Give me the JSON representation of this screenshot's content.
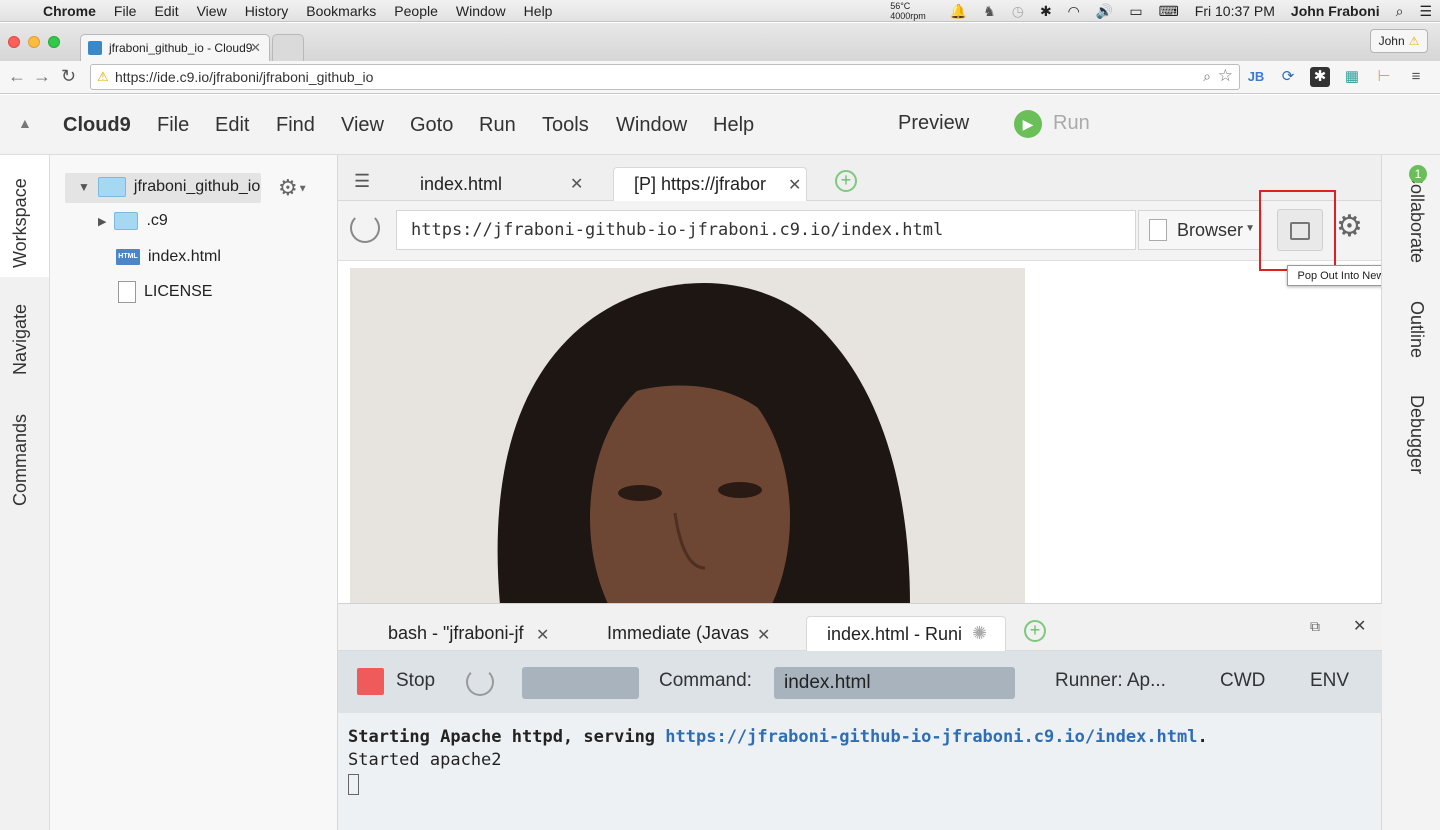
{
  "macbar": {
    "app": "Chrome",
    "menu": [
      "File",
      "Edit",
      "View",
      "History",
      "Bookmarks",
      "People",
      "Window",
      "Help"
    ],
    "temp": "56°C",
    "rpm": "4000rpm",
    "clock": "Fri 10:37 PM",
    "user": "John Fraboni"
  },
  "browser": {
    "tab_title": "jfraboni_github_io - Cloud9",
    "profile": "John",
    "url": "https://ide.c9.io/jfraboni/jfraboni_github_io"
  },
  "ide": {
    "logo": "Cloud9",
    "menu": [
      "File",
      "Edit",
      "Find",
      "View",
      "Goto",
      "Run",
      "Tools",
      "Window",
      "Help"
    ],
    "preview": "Preview",
    "run": "Run"
  },
  "left_tabs": [
    "Workspace",
    "Navigate",
    "Commands"
  ],
  "right_tabs": [
    "Collaborate",
    "Outline",
    "Debugger"
  ],
  "collab_badge": "1",
  "tree": {
    "root": "jfraboni_github_io",
    "items": [
      ".c9",
      "index.html",
      "LICENSE"
    ],
    "html_badge": "HTML"
  },
  "editor": {
    "tabs": [
      "index.html",
      "[P] https://jfrabor"
    ],
    "preview_url": "https://jfraboni-github-io-jfraboni.c9.io/index.html",
    "browser_label": "Browser",
    "tooltip": "Pop Out Into New Window"
  },
  "console": {
    "tabs": [
      "bash - \"jfraboni-jf",
      "Immediate (Javas",
      "index.html - Runi"
    ],
    "stop": "Stop",
    "command_label": "Command:",
    "command_value": "index.html",
    "runner": "Runner: Ap...",
    "cwd": "CWD",
    "env": "ENV",
    "line1_prefix": "Starting Apache httpd, serving ",
    "line1_link": "https://jfraboni-github-io-jfraboni.c9.io/index.html",
    "line1_suffix": ".",
    "line2": "Started apache2"
  },
  "colors": {
    "accent_green": "#6bbf59",
    "stop_red": "#ef5b5b",
    "link_blue": "#2d6eb5",
    "highlight": "#e02020"
  }
}
